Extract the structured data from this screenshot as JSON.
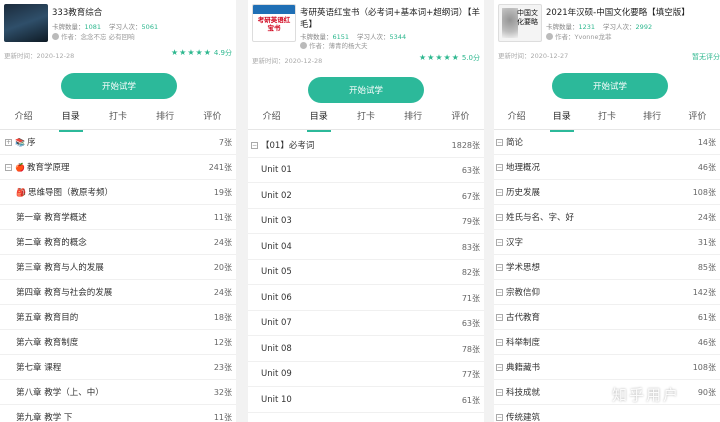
{
  "panel1": {
    "title": "333教育综合",
    "stats_card_label": "卡牌数量：",
    "stats_card_value": "1081",
    "stats_learn_label": "学习人次：",
    "stats_learn_value": "5061",
    "author": "作者：念念不忘 必有回响",
    "updated": "更新时间：2020-12-28",
    "score": "4.9分",
    "try_button": "开始试学",
    "tabs": [
      "介绍",
      "目录",
      "打卡",
      "排行",
      "评价"
    ],
    "rows": [
      {
        "label": "序",
        "count": "7张"
      },
      {
        "label": "教育学原理",
        "count": "241张"
      },
      {
        "label": "思维导图（教原考频）",
        "count": "19张"
      },
      {
        "label": "第一章 教育学概述",
        "count": "11张"
      },
      {
        "label": "第二章 教育的概念",
        "count": "24张"
      },
      {
        "label": "第三章 教育与人的发展",
        "count": "20张"
      },
      {
        "label": "第四章 教育与社会的发展",
        "count": "24张"
      },
      {
        "label": "第五章 教育目的",
        "count": "18张"
      },
      {
        "label": "第六章 教育制度",
        "count": "12张"
      },
      {
        "label": "第七章 课程",
        "count": "23张"
      },
      {
        "label": "第八章 教学（上、中）",
        "count": "32张"
      },
      {
        "label": "第九章 教学 下",
        "count": "11张"
      }
    ]
  },
  "panel2": {
    "cover_text": "考研英语红宝书",
    "title": "考研英语红宝书（必考词+基本词+超纲词）【羊毛】",
    "stats_card_label": "卡牌数量：",
    "stats_card_value": "6151",
    "stats_learn_label": "学习人次：",
    "stats_learn_value": "5344",
    "author": "作者：薄青的杨大夫",
    "updated": "更新时间：2020-12-28",
    "score": "5.0分",
    "try_button": "开始试学",
    "tabs": [
      "介绍",
      "目录",
      "打卡",
      "排行",
      "评价"
    ],
    "rows": [
      {
        "label": "【01】必考词",
        "count": "1828张"
      },
      {
        "label": "Unit 01",
        "count": "63张"
      },
      {
        "label": "Unit 02",
        "count": "67张"
      },
      {
        "label": "Unit 03",
        "count": "79张"
      },
      {
        "label": "Unit 04",
        "count": "83张"
      },
      {
        "label": "Unit 05",
        "count": "82张"
      },
      {
        "label": "Unit 06",
        "count": "71张"
      },
      {
        "label": "Unit 07",
        "count": "63张"
      },
      {
        "label": "Unit 08",
        "count": "78张"
      },
      {
        "label": "Unit 09",
        "count": "77张"
      },
      {
        "label": "Unit 10",
        "count": "61张"
      }
    ]
  },
  "panel3": {
    "cover_text": "中国文化要略",
    "title": "2021年汉硕-中国文化要略【填空版】",
    "stats_card_label": "卡牌数量：",
    "stats_card_value": "1231",
    "stats_learn_label": "学习人次：",
    "stats_learn_value": "2992",
    "author": "作者：Yvonne龙菲",
    "updated": "更新时间：2020-12-27",
    "side_note": "暂无评分",
    "try_button": "开始试学",
    "tabs": [
      "介绍",
      "目录",
      "打卡",
      "排行",
      "评价"
    ],
    "rows": [
      {
        "label": "简论",
        "count": "14张"
      },
      {
        "label": "地理概况",
        "count": "46张"
      },
      {
        "label": "历史发展",
        "count": "108张"
      },
      {
        "label": "姓氏与名、字、好",
        "count": "24张"
      },
      {
        "label": "汉字",
        "count": "31张"
      },
      {
        "label": "学术思想",
        "count": "85张"
      },
      {
        "label": "宗教信仰",
        "count": "142张"
      },
      {
        "label": "古代教育",
        "count": "61张"
      },
      {
        "label": "科举制度",
        "count": "46张"
      },
      {
        "label": "典籍藏书",
        "count": "108张"
      },
      {
        "label": "科技成就",
        "count": "90张"
      },
      {
        "label": "传统建筑",
        "count": ""
      }
    ]
  },
  "watermark": "知乎用户",
  "colors": {
    "accent": "#2cb99a",
    "stat": "#2cb78e"
  }
}
